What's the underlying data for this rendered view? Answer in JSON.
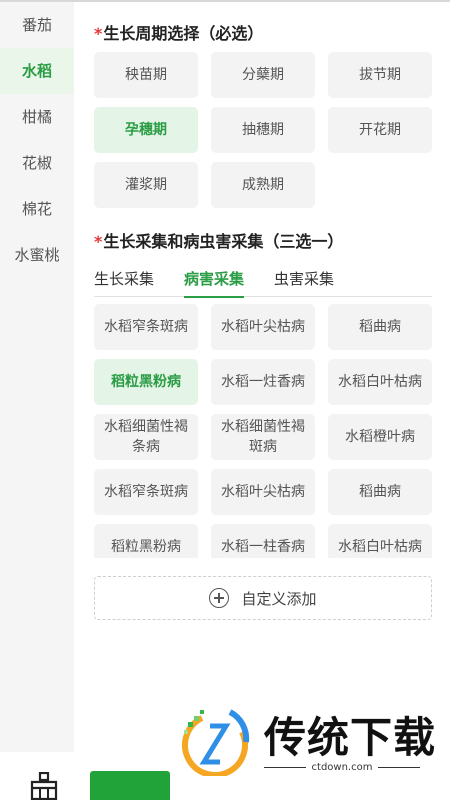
{
  "sidebar": {
    "items": [
      {
        "label": "番茄",
        "active": false
      },
      {
        "label": "水稻",
        "active": true
      },
      {
        "label": "柑橘",
        "active": false
      },
      {
        "label": "花椒",
        "active": false
      },
      {
        "label": "棉花",
        "active": false
      },
      {
        "label": "水蜜桃",
        "active": false
      }
    ]
  },
  "growth_period": {
    "required_mark": "*",
    "title": "生长周期选择（必选）",
    "options": [
      {
        "label": "秧苗期",
        "active": false
      },
      {
        "label": "分蘖期",
        "active": false
      },
      {
        "label": "拔节期",
        "active": false
      },
      {
        "label": "孕穗期",
        "active": true
      },
      {
        "label": "抽穗期",
        "active": false
      },
      {
        "label": "开花期",
        "active": false
      },
      {
        "label": "灌浆期",
        "active": false
      },
      {
        "label": "成熟期",
        "active": false
      }
    ]
  },
  "collection": {
    "required_mark": "*",
    "title": "生长采集和病虫害采集（三选一）",
    "tabs": [
      {
        "label": "生长采集",
        "active": false
      },
      {
        "label": "病害采集",
        "active": true
      },
      {
        "label": "虫害采集",
        "active": false
      }
    ],
    "diseases": [
      {
        "label": "水稻窄条斑病",
        "active": false
      },
      {
        "label": "水稻叶尖枯病",
        "active": false
      },
      {
        "label": "稻曲病",
        "active": false
      },
      {
        "label": "稻粒黑粉病",
        "active": true
      },
      {
        "label": "水稻一炷香病",
        "active": false
      },
      {
        "label": "水稻白叶枯病",
        "active": false
      },
      {
        "label": "水稻细菌性褐条病",
        "active": false
      },
      {
        "label": "水稻细菌性褐斑病",
        "active": false
      },
      {
        "label": "水稻橙叶病",
        "active": false
      },
      {
        "label": "水稻窄条斑病",
        "active": false
      },
      {
        "label": "水稻叶尖枯病",
        "active": false
      },
      {
        "label": "稻曲病",
        "active": false
      },
      {
        "label": "稻粒黑粉病",
        "active": false
      },
      {
        "label": "水稻一柱香病",
        "active": false
      },
      {
        "label": "水稻白叶枯病",
        "active": false
      }
    ],
    "custom_add_label": "自定义添加"
  },
  "watermark": {
    "brand": "传统下载",
    "url": "ctdown.com"
  },
  "colors": {
    "accent": "#2a9d45",
    "required": "#e53935",
    "chip_bg": "#f3f3f3",
    "chip_active_bg": "#e4f4e6",
    "sidebar_bg": "#f5f5f5"
  },
  "icons": {
    "bottom_left": "broom-icon",
    "add": "plus-circle-icon"
  }
}
